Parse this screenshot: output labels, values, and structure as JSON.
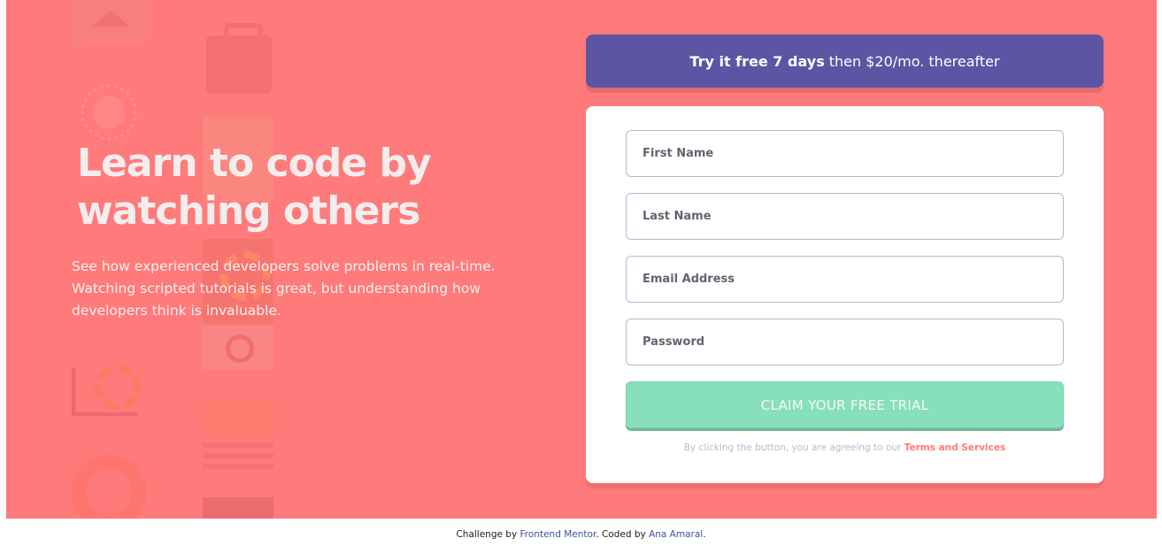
{
  "hero": {
    "headline_line1": "Learn to code by",
    "headline_line2": "watching others",
    "subtext_line1": "See how experienced developers solve problems in real-time.",
    "subtext_line2": "Watching scripted tutorials is great, but understanding how",
    "subtext_line3": "developers think is invaluable.",
    "background_color": "#ff7a7a"
  },
  "offer": {
    "bold": "Try it free 7 days",
    "rest": "then $20/mo. thereafter",
    "color": "#5e54a4"
  },
  "form": {
    "first_name_placeholder": "First Name",
    "last_name_placeholder": "Last Name",
    "email_placeholder": "Email Address",
    "password_placeholder": "Password",
    "submit_label": "CLAIM YOUR FREE TRIAL",
    "submit_color": "#88dfbb",
    "terms_prefix": "By clicking the button, you are agreeing to our",
    "terms_link": "Terms and Services"
  },
  "footer": {
    "challenge_prefix": "Challenge by",
    "challenge_link": "Frontend Mentor",
    "coded_prefix": ". Coded by",
    "coded_link": "Ana Amaral",
    "suffix": "."
  },
  "icons": [
    "house-icon",
    "toolbox-icon",
    "network-icon",
    "developer-icon",
    "gear-icon",
    "search-icon",
    "cart-icon",
    "key-icon",
    "code-lines-icon",
    "lifebuoy-icon",
    "panel-icon"
  ]
}
